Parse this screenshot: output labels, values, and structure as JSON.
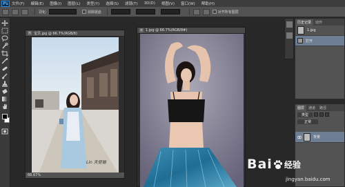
{
  "app": {
    "logo": "Ps"
  },
  "menu": [
    "文件(F)",
    "编辑(E)",
    "图像(I)",
    "图层(L)",
    "类型(Y)",
    "选择(S)",
    "滤镜(T)",
    "3D(D)",
    "视图(V)",
    "窗口(W)",
    "帮助(H)"
  ],
  "options": {
    "feather_label": "羽化:",
    "checkbox_label": "消除锯齿",
    "align_label": "对齐所有图层"
  },
  "doc_left": {
    "title": "宝贝.jpg @ 66.7%(RGB/8)",
    "zoom": "66.67%",
    "signature": "Lin 天使猫"
  },
  "doc_right": {
    "title": "1.jpg @ 66.7%(RGB/8#)"
  },
  "panel_top": {
    "tabs": [
      "历史记录",
      "动作"
    ],
    "rows": [
      "1.jpg",
      "打开"
    ]
  },
  "panel_layers": {
    "tabs": [
      "图层",
      "通道",
      "路径"
    ],
    "kind": "类型",
    "blend": "正常",
    "layer_name": "背景"
  },
  "watermark": {
    "left": "Bai",
    "right": "经验",
    "url": "jingyan.baidu.com"
  },
  "colors": {
    "accent": "#2a8ae0",
    "selection": "#6e7e92",
    "workspace": "#282828"
  }
}
